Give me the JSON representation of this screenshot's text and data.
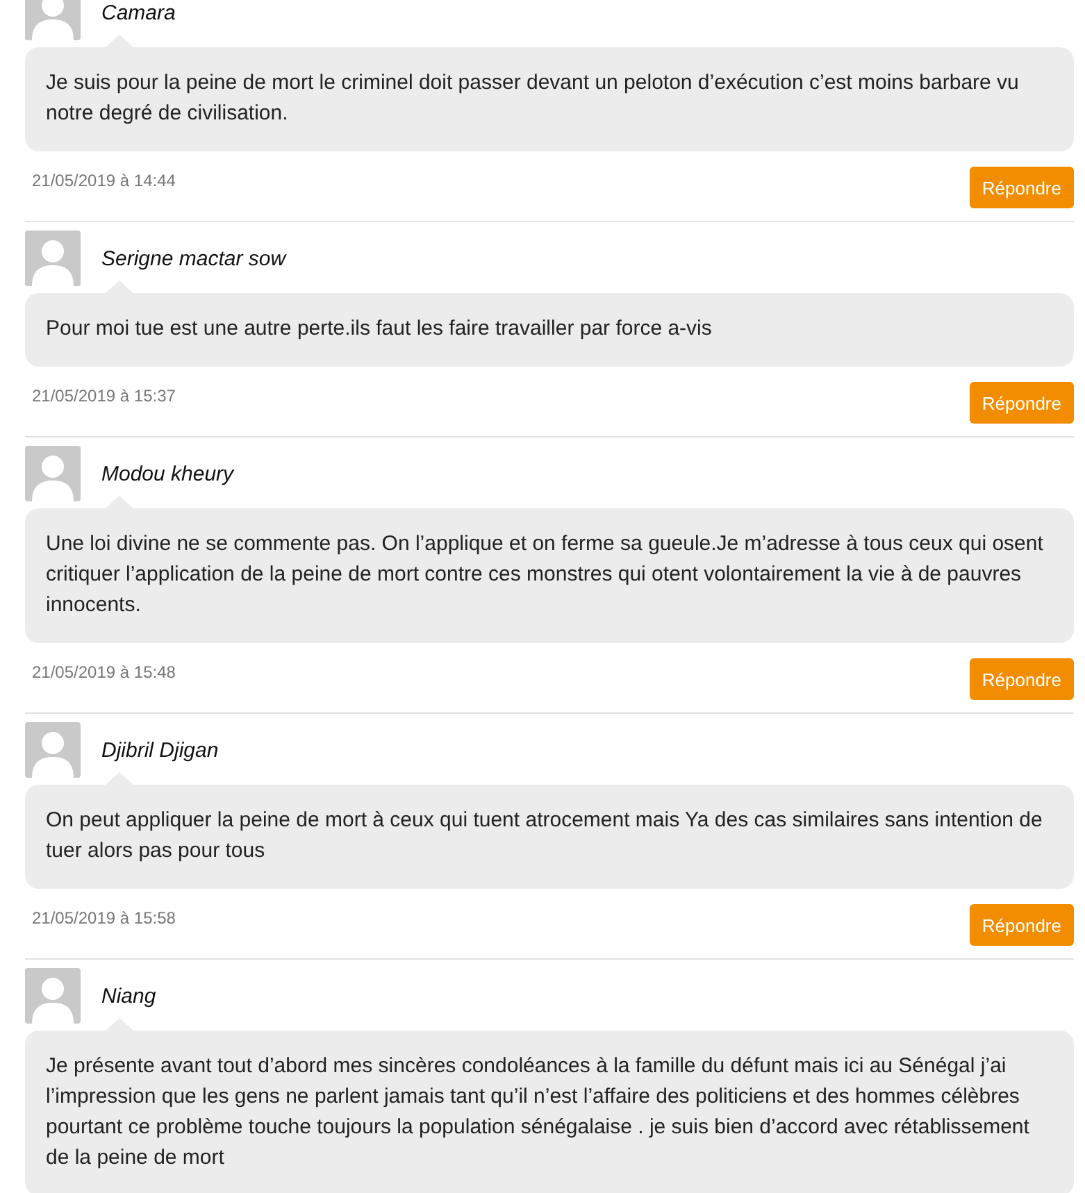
{
  "comments": [
    {
      "author": "Camara",
      "text": "Je suis pour la peine de mort le criminel doit passer devant un peloton d’exécution c’est moins barbare vu notre degré de civilisation.",
      "date": "21/05/2019 à 14:44",
      "reply": "Répondre"
    },
    {
      "author": "Serigne mactar sow",
      "text": "Pour moi tue est une autre perte.ils faut les faire travailler par force a-vis",
      "date": "21/05/2019 à 15:37",
      "reply": "Répondre"
    },
    {
      "author": "Modou kheury",
      "text": "Une loi divine ne se commente pas. On l’applique et on ferme sa gueule.Je m’adresse à tous ceux qui osent critiquer l’application de la peine de mort contre ces monstres qui otent volontairement la vie à de pauvres innocents.",
      "date": "21/05/2019 à 15:48",
      "reply": "Répondre"
    },
    {
      "author": "Djibril Djigan",
      "text": "On peut appliquer la peine de mort à ceux qui tuent atrocement mais Ya des cas similaires sans intention de tuer alors pas pour tous",
      "date": "21/05/2019 à 15:58",
      "reply": "Répondre"
    },
    {
      "author": "Niang",
      "text": "Je présente avant tout d’abord mes sincères condoléances à la famille du défunt mais ici au Sénégal j’ai l’impression que les gens ne parlent jamais tant qu’il n’est l’affaire des politiciens et des hommes célèbres pourtant ce problème touche toujours la population sénégalaise . je suis bien d’accord avec rétablissement de la peine de mort"
    }
  ]
}
